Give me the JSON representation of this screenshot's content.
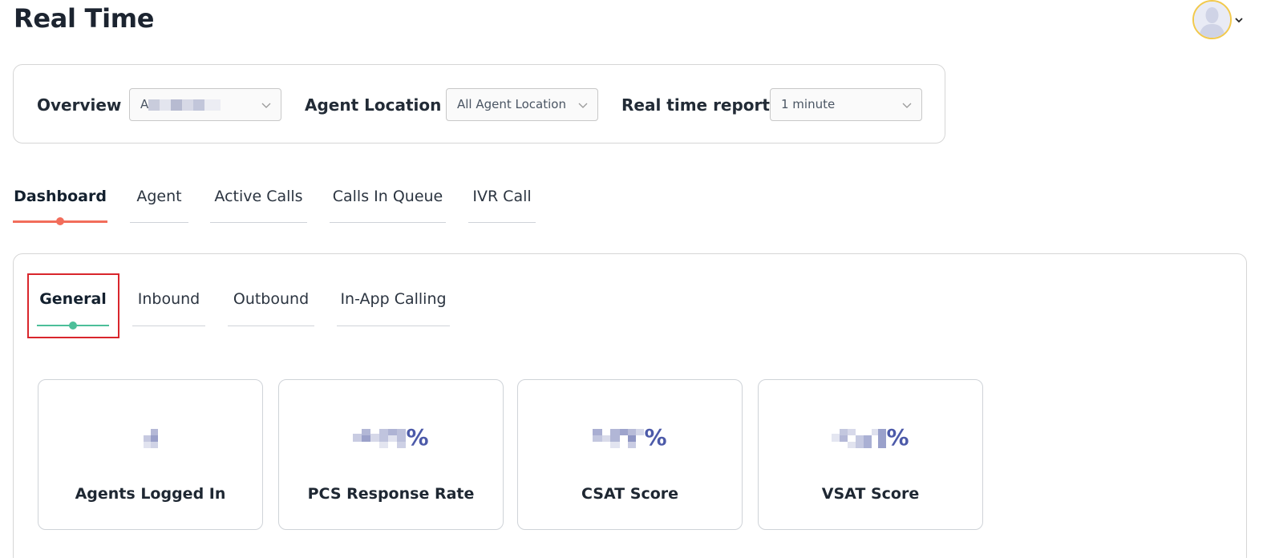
{
  "header": {
    "title": "Real Time",
    "avatar_icon": "user-avatar-icon"
  },
  "filters": {
    "overview_label": "Overview",
    "overview_value": "A",
    "agent_location_label": "Agent Location",
    "agent_location_value": "All Agent Location",
    "realtime_label": "Real time report",
    "realtime_value": "1 minute"
  },
  "main_tabs": [
    {
      "label": "Dashboard",
      "active": true
    },
    {
      "label": "Agent",
      "active": false
    },
    {
      "label": "Active Calls",
      "active": false
    },
    {
      "label": "Calls In Queue",
      "active": false
    },
    {
      "label": "IVR Call",
      "active": false
    }
  ],
  "sub_tabs": [
    {
      "label": "General",
      "active": true
    },
    {
      "label": "Inbound",
      "active": false
    },
    {
      "label": "Outbound",
      "active": false
    },
    {
      "label": "In-App Calling",
      "active": false
    }
  ],
  "metrics": [
    {
      "label": "Agents Logged In",
      "suffix": ""
    },
    {
      "label": "PCS Response Rate",
      "suffix": "%"
    },
    {
      "label": "CSAT Score",
      "suffix": "%"
    },
    {
      "label": "VSAT Score",
      "suffix": "%"
    }
  ],
  "colors": {
    "accent_main_tab": "#f26d5b",
    "accent_sub_tab": "#4cbf99",
    "metric_value": "#4c5aa9",
    "highlight": "#d9262c"
  }
}
